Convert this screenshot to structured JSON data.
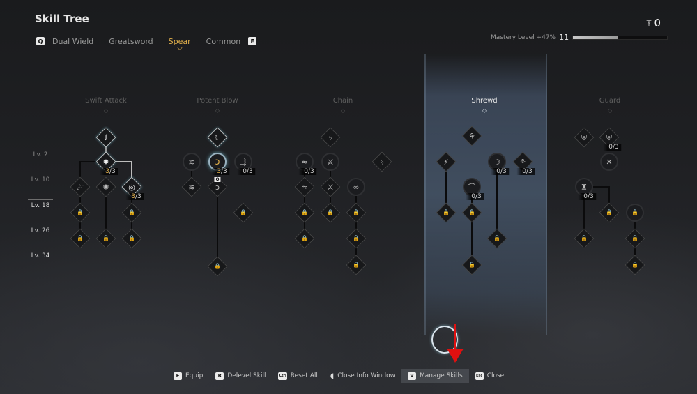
{
  "header": {
    "title": "Skill Tree",
    "prev_key": "Q",
    "next_key": "E",
    "tabs": [
      {
        "label": "Dual Wield",
        "active": false
      },
      {
        "label": "Greatsword",
        "active": false
      },
      {
        "label": "Spear",
        "active": true
      },
      {
        "label": "Common",
        "active": false
      }
    ],
    "currency": {
      "icon": "skill-point-icon",
      "glyph": "₮",
      "value": "0"
    },
    "mastery": {
      "label": "Mastery Level +47%",
      "level": "11",
      "progress_fraction": 0.47
    }
  },
  "levels": [
    "Lv. 2",
    "Lv. 10",
    "Lv. 18",
    "Lv. 26",
    "Lv. 34"
  ],
  "columns": [
    {
      "name": "Swift Attack",
      "active": false
    },
    {
      "name": "Potent Blow",
      "active": false
    },
    {
      "name": "Chain",
      "active": false
    },
    {
      "name": "Shrewd",
      "active": true
    },
    {
      "name": "Guard",
      "active": false
    }
  ],
  "node_counts": {
    "swift_2": {
      "cur": "3",
      "max": "3",
      "gold": true
    },
    "swift_3": {
      "cur": "3",
      "max": "3",
      "gold": true
    },
    "potent_gold": {
      "cur": "3",
      "max": "3",
      "gold": true
    },
    "potent_arrows": {
      "cur": "0",
      "max": "3",
      "gold": false
    },
    "chain_1": {
      "cur": "0",
      "max": "3",
      "gold": false
    },
    "shrewd_circle1": {
      "cur": "0",
      "max": "3",
      "gold": false
    },
    "shrewd_diamond": {
      "cur": "0",
      "max": "3",
      "gold": false
    },
    "shrewd_circle2": {
      "cur": "0",
      "max": "3",
      "gold": false
    },
    "guard_shield2": {
      "cur": "0",
      "max": "3",
      "gold": false
    },
    "guard_circle": {
      "cur": "0",
      "max": "3",
      "gold": false
    }
  },
  "equipped_key": "Q",
  "bottom_bar": [
    {
      "key": "F",
      "label": "Equip"
    },
    {
      "key": "R",
      "label": "Delevel Skill"
    },
    {
      "key": "Ctrl",
      "label": "Reset All"
    },
    {
      "icon": "mouse-icon",
      "label": "Close Info Window"
    },
    {
      "key": "V",
      "label": "Manage Skills",
      "active": true
    },
    {
      "key": "Esc",
      "label": "Close"
    }
  ]
}
